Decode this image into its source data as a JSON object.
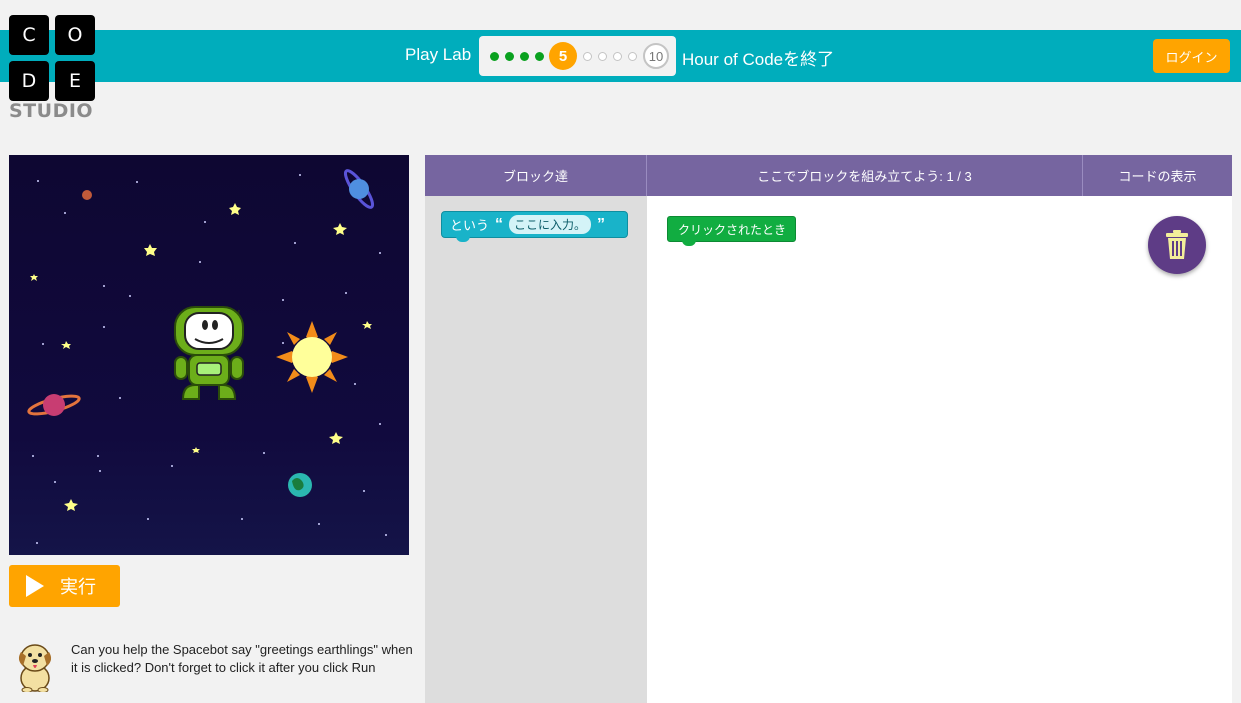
{
  "logo": {
    "letters": [
      "C",
      "O",
      "D",
      "E"
    ],
    "studio": "STUDIO"
  },
  "header": {
    "lab_title": "Play Lab",
    "current_level": "5",
    "last_level": "10",
    "finish_link": "Hour of Codeを終了",
    "login_label": "ログイン"
  },
  "progress": {
    "current": 5,
    "total": 10,
    "completed": 4
  },
  "run": {
    "label": "実行"
  },
  "instructions": {
    "text": "Can you help the Spacebot say \"greetings earthlings\" when it is clicked? Don't forget to click it after you click Run"
  },
  "workspace": {
    "col_toolbox": "ブロック達",
    "col_workspace": "ここでブロックを組み立てよう: 1 / 3",
    "col_show_code": "コードの表示"
  },
  "blocks": {
    "say_label": "という",
    "say_open_quote": "“",
    "say_placeholder": "ここに入力。",
    "say_close_quote": "”",
    "event_label": "クリックされたとき"
  },
  "icons": {
    "trash": "trash-icon",
    "play": "play-icon",
    "dog": "dog-mascot-icon"
  },
  "colors": {
    "header": "#00adbc",
    "accent": "#ffa400",
    "workspace_header": "#7665a0",
    "say_block": "#19b3c9",
    "event_block": "#11ad41",
    "trash": "#5e3c86"
  }
}
